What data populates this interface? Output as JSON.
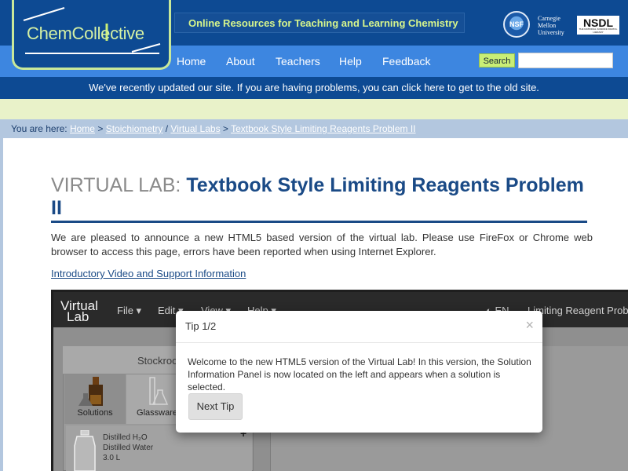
{
  "header": {
    "logo_text": "ChemCollective",
    "tagline": "Online Resources for Teaching and Learning Chemistry",
    "partners": {
      "nsf": "NSF",
      "cmu_lines": [
        "Carnegie",
        "Mellon",
        "University"
      ],
      "nsdl": "NSDL",
      "nsdl_sub": "THE NATIONAL SCIENCE DIGITAL LIBRARY"
    }
  },
  "nav": {
    "items": [
      {
        "label": "Home"
      },
      {
        "label": "About"
      },
      {
        "label": "Teachers"
      },
      {
        "label": "Help"
      },
      {
        "label": "Feedback"
      }
    ],
    "search_button": "Search",
    "search_value": ""
  },
  "notice": "We've recently updated our site. If you are having problems, you can click here to get to the old site.",
  "breadcrumb": {
    "prefix": "You are here:",
    "items": [
      "Home",
      "Stoichiometry",
      "Virtual Labs",
      "Textbook Style Limiting Reagents Problem II"
    ],
    "separators": [
      ">",
      "/",
      ">"
    ]
  },
  "page": {
    "title_prefix": "VIRTUAL LAB:",
    "title": "Textbook Style Limiting Reagents Problem II",
    "intro": "We are pleased to announce a new HTML5 based version of the virtual lab. Please use FireFox or Chrome web browser to access this page, errors have been reported when using Internet Explorer.",
    "video_link": "Introductory Video and Support Information"
  },
  "app": {
    "logo_line1": "Virtual",
    "logo_line2": "Lab",
    "menus": [
      "File ▾",
      "Edit ▾",
      "View ▾",
      "Help ▾"
    ],
    "language": "EN",
    "problem_title": "Limiting Reagent Problem",
    "stockroom": {
      "title": "Stockroom",
      "tabs": [
        "Solutions",
        "Glassware"
      ],
      "item": {
        "line1": "Distilled H₂O",
        "line2": "Distilled Water",
        "line3": "3.0 L"
      },
      "add_symbol": "+"
    }
  },
  "modal": {
    "title": "Tip 1/2",
    "close": "×",
    "body": "Welcome to the new HTML5 version of the Virtual Lab! In this version, the Solution Information Panel is now located on the left and appears when a solution is selected.",
    "button": "Next Tip"
  }
}
